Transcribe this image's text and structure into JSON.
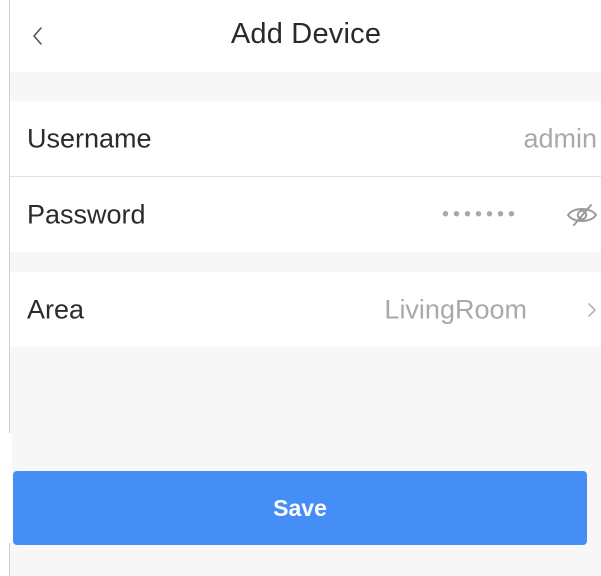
{
  "nav": {
    "title": "Add Device",
    "back_icon": "chevron-left-icon"
  },
  "form": {
    "username": {
      "label": "Username",
      "value": "admin"
    },
    "password": {
      "label": "Password",
      "masked_value": "•••••••",
      "toggle_icon": "eye-slash-icon"
    },
    "area": {
      "label": "Area",
      "value": "LivingRoom",
      "chevron_icon": "chevron-right-icon"
    }
  },
  "actions": {
    "save_label": "Save"
  },
  "colors": {
    "primary": "#448ef6",
    "background": "#f7f7f7",
    "value_text": "#a9a9a9"
  }
}
